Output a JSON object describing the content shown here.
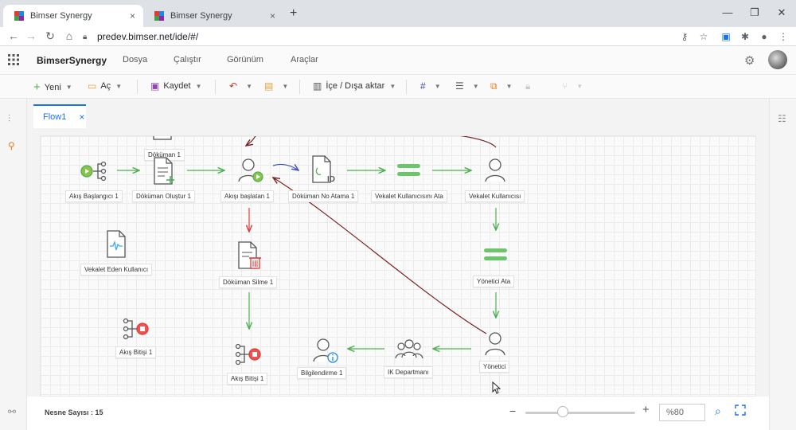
{
  "browser": {
    "tabs": [
      {
        "title": "Bimser Synergy",
        "close": "×"
      },
      {
        "title": "Bimser Synergy",
        "close": "×"
      }
    ],
    "new_tab": "+",
    "url": "predev.bimser.net/ide/#/",
    "window": {
      "minimize": "—",
      "restore": "❐",
      "close": "✕"
    }
  },
  "app": {
    "brand": "BimserSynergy",
    "menu": [
      "Dosya",
      "Çalıştır",
      "Görünüm",
      "Araçlar"
    ]
  },
  "toolbar": {
    "new_label": "Yeni",
    "open_label": "Aç",
    "save_label": "Kaydet",
    "import_export_label": "İçe / Dışa aktar"
  },
  "document_tab": {
    "title": "Flow1",
    "close": "×"
  },
  "nodes": [
    {
      "id": "start",
      "label": "Akış Başlangıcı 1",
      "icon": "flow-start-icon"
    },
    {
      "id": "doc-create",
      "label": "Döküman Oluştur 1",
      "icon": "document-add-icon"
    },
    {
      "id": "doc-top",
      "label": "Döküman 1",
      "icon": "document-icon"
    },
    {
      "id": "flow-start-user",
      "label": "Akışı başlatan 1",
      "icon": "user-start-icon"
    },
    {
      "id": "doc-number",
      "label": "Döküman No Atama 1",
      "icon": "document-id-icon"
    },
    {
      "id": "assign-proxy",
      "label": "Vekalet Kullanıcısını Ata",
      "icon": "assign-icon"
    },
    {
      "id": "proxy-user",
      "label": "Vekalet Kullanıcısı",
      "icon": "user-icon"
    },
    {
      "id": "proxy-giver",
      "label": "Vekalet Eden Kullanıcı",
      "icon": "document-wave-icon"
    },
    {
      "id": "doc-delete",
      "label": "Döküman Silme 1",
      "icon": "document-delete-icon"
    },
    {
      "id": "assign-manager",
      "label": "Yönetici Ata",
      "icon": "assign-icon"
    },
    {
      "id": "end-left",
      "label": "Akış Bitişi 1",
      "icon": "flow-end-icon"
    },
    {
      "id": "end-center",
      "label": "Akış Bitişi 1",
      "icon": "flow-end-icon"
    },
    {
      "id": "info",
      "label": "Bilgilendirme 1",
      "icon": "user-info-icon"
    },
    {
      "id": "hr",
      "label": "IK Departmanı",
      "icon": "group-icon"
    },
    {
      "id": "manager",
      "label": "Yönetici",
      "icon": "user-icon"
    }
  ],
  "status": {
    "object_count": "Nesne Sayısı : 15",
    "zoom_minus": "−",
    "zoom_plus": "+",
    "zoom_value": "%80",
    "zoom_level": 0.34
  },
  "colors": {
    "accent": "#1a73e8",
    "flow_green": "#4caf50",
    "flow_red": "#e53935",
    "flow_blue": "#3f51b5",
    "flow_dark_red": "#7b1f1f"
  }
}
